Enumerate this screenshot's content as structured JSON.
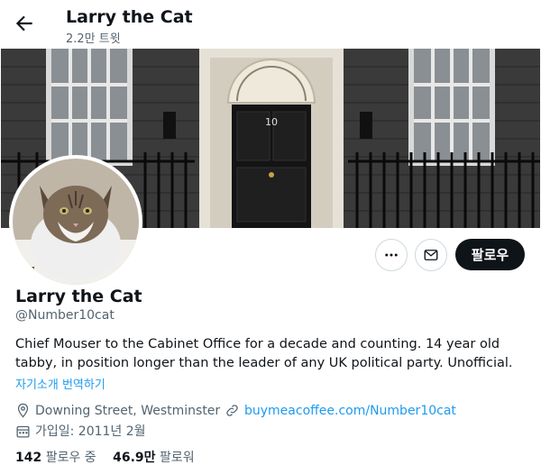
{
  "header": {
    "title": "Larry the Cat",
    "subtitle": "2.2만 트윗"
  },
  "banner": {
    "door_number": "10"
  },
  "actions": {
    "follow_label": "팔로우"
  },
  "profile": {
    "name": "Larry the Cat",
    "handle": "@Number10cat",
    "bio": "Chief Mouser to the Cabinet Office for a decade and counting. 14 year old tabby, in position longer than the leader of any UK political party. Unofficial.",
    "translate_label": "자기소개 번역하기",
    "location": "Downing Street, Westminster",
    "website": "buymeacoffee.com/Number10cat",
    "joined": "가입일: 2011년 2월"
  },
  "stats": {
    "following_count": "142",
    "following_label": "팔로우 중",
    "followers_count": "46.9만",
    "followers_label": "팔로워"
  },
  "colors": {
    "accent": "#1d9bf0",
    "text": "#0f1419",
    "muted": "#536471",
    "button_dark": "#0f1419"
  }
}
